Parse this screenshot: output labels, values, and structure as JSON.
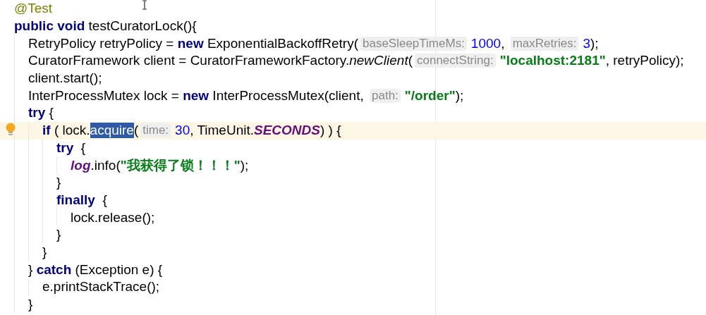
{
  "editor": {
    "lines": [
      {
        "current": false,
        "tokens": [
          {
            "kind": "annotation",
            "text": "@Test"
          }
        ]
      },
      {
        "current": false,
        "tokens": [
          {
            "kind": "keyword",
            "text": "public void"
          },
          {
            "kind": "plain",
            "text": " testCuratorLock(){"
          }
        ],
        "children": [
          {
            "current": false,
            "tokens": [
              {
                "kind": "plain",
                "text": "RetryPolicy retryPolicy = "
              },
              {
                "kind": "keyword",
                "text": "new"
              },
              {
                "kind": "plain",
                "text": " ExponentialBackoffRetry("
              },
              {
                "kind": "hint",
                "text": "baseSleepTimeMs:"
              },
              {
                "kind": "number",
                "text": "1000"
              },
              {
                "kind": "plain",
                "text": ", "
              },
              {
                "kind": "hint",
                "text": "maxRetries:"
              },
              {
                "kind": "number",
                "text": "3"
              },
              {
                "kind": "plain",
                "text": ");"
              }
            ]
          },
          {
            "current": false,
            "tokens": [
              {
                "kind": "plain",
                "text": "CuratorFramework client = CuratorFrameworkFactory."
              },
              {
                "kind": "italic",
                "text": "newClient"
              },
              {
                "kind": "plain",
                "text": "("
              },
              {
                "kind": "hint",
                "text": "connectString:"
              },
              {
                "kind": "string",
                "text": "\"localhost:2181\""
              },
              {
                "kind": "plain",
                "text": ", retryPolicy);"
              }
            ]
          },
          {
            "current": false,
            "tokens": [
              {
                "kind": "plain",
                "text": "client.start();"
              }
            ]
          },
          {
            "current": false,
            "tokens": [
              {
                "kind": "plain",
                "text": "InterProcessMutex lock = "
              },
              {
                "kind": "keyword",
                "text": "new"
              },
              {
                "kind": "plain",
                "text": " InterProcessMutex(client, "
              },
              {
                "kind": "hint",
                "text": "path:"
              },
              {
                "kind": "string",
                "text": "\"/order\""
              },
              {
                "kind": "plain",
                "text": ");"
              }
            ]
          },
          {
            "current": false,
            "tokens": [
              {
                "kind": "keyword",
                "text": "try"
              },
              {
                "kind": "plain",
                "text": " {"
              }
            ],
            "children": [
              {
                "current": true,
                "tokens": [
                  {
                    "kind": "keyword",
                    "text": "if"
                  },
                  {
                    "kind": "plain",
                    "text": " ( lock."
                  },
                  {
                    "kind": "selection",
                    "text": "acquire"
                  },
                  {
                    "kind": "plain",
                    "text": "("
                  },
                  {
                    "kind": "hint",
                    "text": "time:"
                  },
                  {
                    "kind": "number",
                    "text": "30"
                  },
                  {
                    "kind": "plain",
                    "text": ", TimeUnit."
                  },
                  {
                    "kind": "static",
                    "text": "SECONDS"
                  },
                  {
                    "kind": "plain",
                    "text": ") ) {"
                  }
                ],
                "children": [
                  {
                    "current": false,
                    "tokens": [
                      {
                        "kind": "keyword",
                        "text": "try"
                      },
                      {
                        "kind": "plain",
                        "text": "  {"
                      }
                    ],
                    "children": [
                      {
                        "current": false,
                        "tokens": [
                          {
                            "kind": "static",
                            "text": "log"
                          },
                          {
                            "kind": "plain",
                            "text": ".info("
                          },
                          {
                            "kind": "string",
                            "text": "\"我获得了锁！！！\""
                          },
                          {
                            "kind": "plain",
                            "text": ");"
                          }
                        ]
                      }
                    ]
                  },
                  {
                    "current": false,
                    "tokens": [
                      {
                        "kind": "plain",
                        "text": "}"
                      }
                    ]
                  },
                  {
                    "current": false,
                    "tokens": [
                      {
                        "kind": "keyword",
                        "text": "finally"
                      },
                      {
                        "kind": "plain",
                        "text": "  {"
                      }
                    ],
                    "children": [
                      {
                        "current": false,
                        "tokens": [
                          {
                            "kind": "plain",
                            "text": "lock.release();"
                          }
                        ]
                      }
                    ]
                  },
                  {
                    "current": false,
                    "tokens": [
                      {
                        "kind": "plain",
                        "text": "}"
                      }
                    ]
                  }
                ]
              },
              {
                "current": false,
                "tokens": [
                  {
                    "kind": "plain",
                    "text": "}"
                  }
                ]
              }
            ]
          },
          {
            "current": false,
            "tokens": [
              {
                "kind": "plain",
                "text": "} "
              },
              {
                "kind": "keyword",
                "text": "catch"
              },
              {
                "kind": "plain",
                "text": " (Exception e) {"
              }
            ],
            "children": [
              {
                "current": false,
                "tokens": [
                  {
                    "kind": "plain",
                    "text": "e.printStackTrace();"
                  }
                ]
              }
            ]
          },
          {
            "current": false,
            "tokens": [
              {
                "kind": "plain",
                "text": "}"
              }
            ]
          }
        ]
      }
    ]
  }
}
